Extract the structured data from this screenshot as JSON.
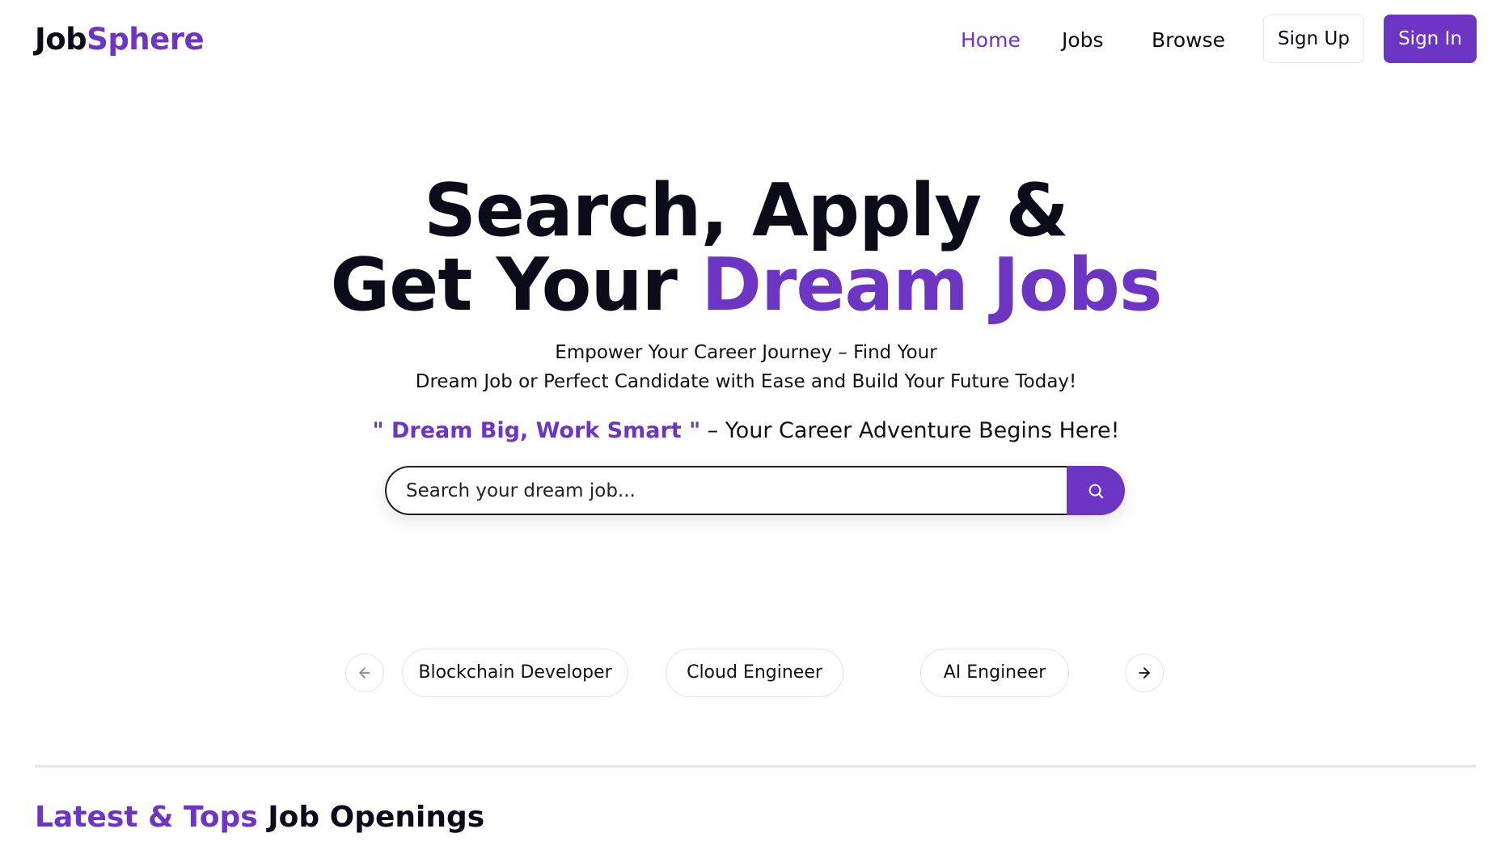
{
  "brand": {
    "logo_dark": "Job",
    "logo_accent": "Sphere"
  },
  "nav": {
    "links": [
      {
        "label": "Home",
        "active": true
      },
      {
        "label": "Jobs",
        "active": false
      },
      {
        "label": "Browse",
        "active": false
      }
    ],
    "signup_label": "Sign Up",
    "signin_label": "Sign In"
  },
  "hero": {
    "title_line1": "Search, Apply &",
    "title_line2_dark": "Get Your ",
    "title_line2_accent": "Dream Jobs",
    "subtitle_line1": "Empower Your Career Journey – Find Your",
    "subtitle_line2": "Dream Job or Perfect Candidate with Ease and Build Your Future Today!",
    "tagline_quote": "\" Dream Big, Work Smart \"",
    "tagline_rest": " – Your Career Adventure Begins Here!"
  },
  "search": {
    "placeholder": "Search your dream job...",
    "value": "",
    "button_icon": "search-icon"
  },
  "categories": {
    "prev_icon": "arrow-left-icon",
    "next_icon": "arrow-right-icon",
    "items": [
      "Blockchain Developer",
      "Cloud Engineer",
      "AI Engineer"
    ]
  },
  "latest": {
    "title_accent": "Latest & Tops",
    "title_dark": " Job Openings"
  },
  "colors": {
    "accent": "#6c35c4",
    "text": "#0b0b1a",
    "divider": "#e2e8f0"
  }
}
